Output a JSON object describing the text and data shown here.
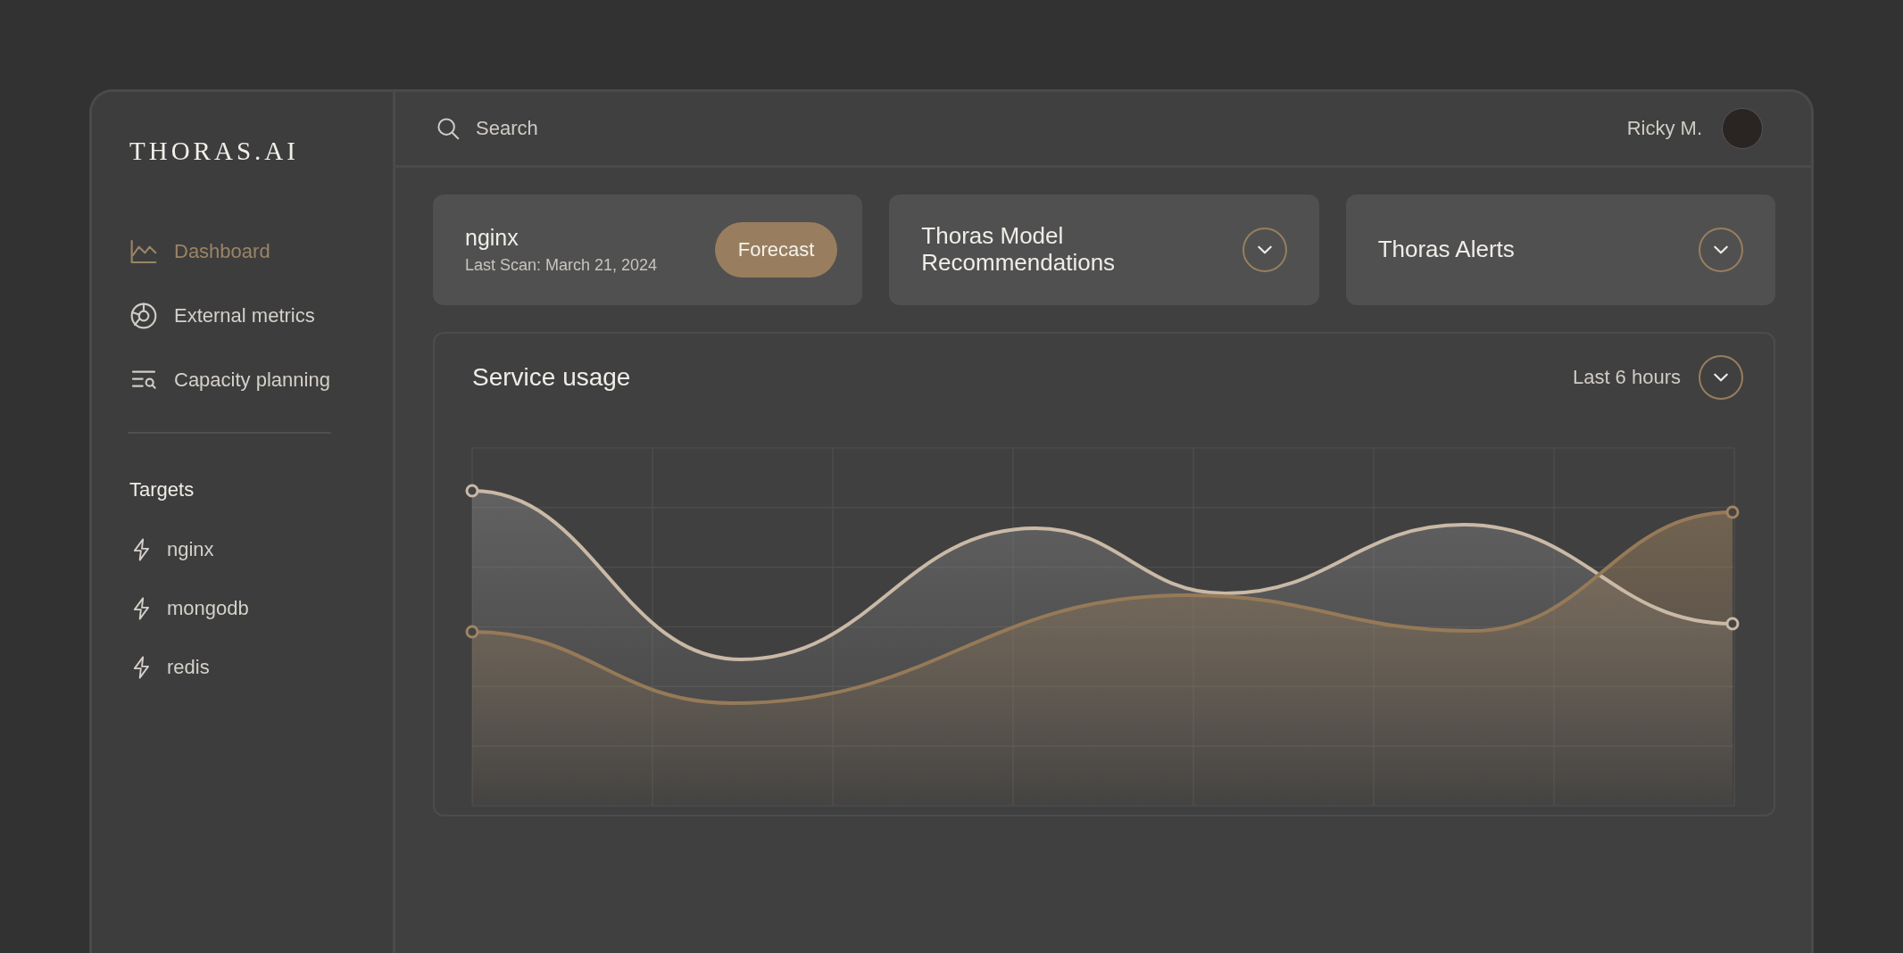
{
  "sidebar": {
    "logo": "THORAS.AI",
    "nav": [
      {
        "label": "Dashboard",
        "selected": true
      },
      {
        "label": "External metrics",
        "selected": false
      },
      {
        "label": "Capacity planning",
        "selected": false
      }
    ],
    "targets_heading": "Targets",
    "targets": [
      {
        "label": "nginx"
      },
      {
        "label": "mongodb"
      },
      {
        "label": "redis"
      }
    ]
  },
  "header": {
    "search": {
      "placeholder": "Search"
    },
    "user_name": "Ricky M."
  },
  "cards": [
    {
      "kind": "target",
      "title": "nginx",
      "subtitle": "Last Scan: March 21, 2024",
      "button": "Forecast"
    },
    {
      "kind": "dropdown",
      "title": "Thoras Model Recommendations"
    },
    {
      "kind": "dropdown",
      "title": "Thoras Alerts"
    }
  ],
  "service_usage": {
    "title": "Service usage",
    "range": "Last 6 hours"
  }
}
